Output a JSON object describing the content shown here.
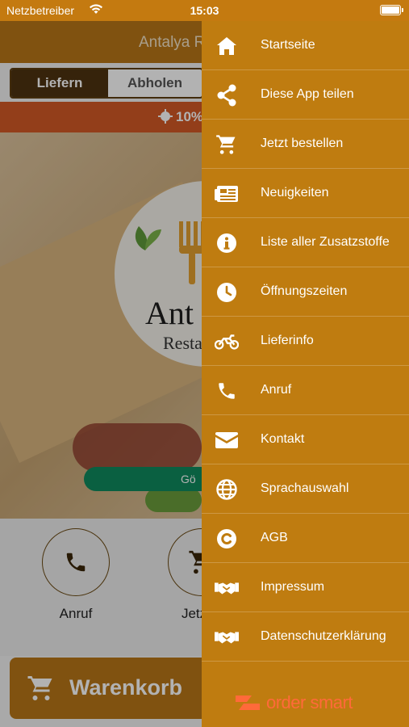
{
  "status_bar": {
    "carrier": "Netzbetreiber",
    "time": "15:03"
  },
  "app": {
    "title": "Antalya R",
    "order_mode": {
      "active": "Liefern",
      "inactive": "Abholen"
    },
    "promo": "10%",
    "logo": {
      "name": "Ant",
      "sub": "Resta"
    },
    "open_status": "Gö",
    "actions": [
      {
        "label": "Anruf",
        "icon": "phone-icon"
      },
      {
        "label": "Jetzt b",
        "icon": "cart-icon"
      }
    ],
    "cart_button": "Warenkorb"
  },
  "drawer": {
    "items": [
      {
        "label": "Startseite",
        "icon": "home-icon"
      },
      {
        "label": "Diese App teilen",
        "icon": "share-icon"
      },
      {
        "label": "Jetzt bestellen",
        "icon": "cart-icon"
      },
      {
        "label": "Neuigkeiten",
        "icon": "newspaper-icon"
      },
      {
        "label": "Liste aller Zusatzstoffe",
        "icon": "info-icon"
      },
      {
        "label": "Öffnungszeiten",
        "icon": "clock-icon"
      },
      {
        "label": "Lieferinfo",
        "icon": "motorbike-icon"
      },
      {
        "label": "Anruf",
        "icon": "phone-icon"
      },
      {
        "label": "Kontakt",
        "icon": "envelope-icon"
      },
      {
        "label": "Sprachauswahl",
        "icon": "globe-icon"
      },
      {
        "label": "AGB",
        "icon": "copyright-icon"
      },
      {
        "label": "Impressum",
        "icon": "handshake-icon"
      },
      {
        "label": "Datenschutzerklärung",
        "icon": "handshake-icon"
      }
    ],
    "brand": "order smart"
  },
  "colors": {
    "drawer": "#bf7c10",
    "header": "#b87618",
    "promo": "#d35a26",
    "open": "#0f8a5e",
    "brand": "#ff6a3a"
  }
}
